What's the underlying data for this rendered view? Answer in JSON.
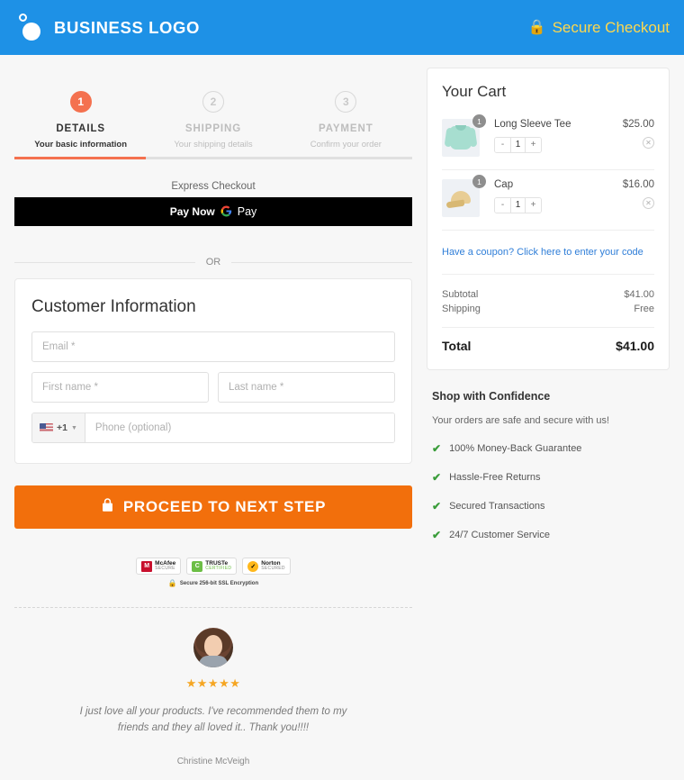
{
  "header": {
    "brand_name": "BUSINESS LOGO",
    "secure_label": "Secure Checkout",
    "lock_icon": "lock-icon",
    "bg_color": "#1e91e6",
    "secure_color": "#ffd84d"
  },
  "stepper": {
    "accent_color": "#f4714f",
    "progress_percent": 33,
    "steps": [
      {
        "number": "1",
        "title": "DETAILS",
        "subtitle": "Your basic information",
        "state": "active"
      },
      {
        "number": "2",
        "title": "SHIPPING",
        "subtitle": "Your shipping details",
        "state": "idle"
      },
      {
        "number": "3",
        "title": "PAYMENT",
        "subtitle": "Confirm your order",
        "state": "idle"
      }
    ]
  },
  "express": {
    "label": "Express Checkout",
    "pay_now": "Pay Now",
    "g_logo": "G",
    "pay_word": "Pay",
    "or_text": "OR"
  },
  "form": {
    "title": "Customer Information",
    "email_placeholder": "Email *",
    "email_value": "",
    "first_name_placeholder": "First name *",
    "first_name_value": "",
    "last_name_placeholder": "Last name *",
    "last_name_value": "",
    "country_code": "+1",
    "flag_icon": "us-flag-icon",
    "phone_placeholder": "Phone (optional)",
    "phone_value": ""
  },
  "cta": {
    "label": "PROCEED TO NEXT STEP",
    "lock_icon": "lock-icon",
    "color": "#f26f0c"
  },
  "trust": {
    "badges": [
      {
        "top": "McAfee",
        "bottom": "SECURE",
        "icon": "mcafee-shield-icon",
        "mark": "M"
      },
      {
        "top": "TRUSTe",
        "bottom": "CERTIFIED",
        "icon": "truste-icon",
        "mark": "C"
      },
      {
        "top": "Norton",
        "bottom": "SECURED",
        "icon": "norton-check-icon",
        "mark": "✓"
      }
    ],
    "ssl_text": "Secure 256-bit SSL Encryption",
    "ssl_icon": "lock-icon"
  },
  "testimonial": {
    "avatar_icon": "customer-avatar",
    "stars": "★★★★★",
    "rating": 5,
    "quote": "I just love all your products. I've recommended them to my friends and they all loved it.. Thank you!!!!",
    "author": "Christine McVeigh"
  },
  "cart": {
    "title": "Your Cart",
    "items": [
      {
        "name": "Long Sleeve Tee",
        "price": "$25.00",
        "qty": "1",
        "qty_badge": "1",
        "image_icon": "long-sleeve-tee-image",
        "minus": "-",
        "plus": "+",
        "remove_icon": "remove-item-icon"
      },
      {
        "name": "Cap",
        "price": "$16.00",
        "qty": "1",
        "qty_badge": "1",
        "image_icon": "cap-image",
        "minus": "-",
        "plus": "+",
        "remove_icon": "remove-item-icon"
      }
    ],
    "coupon_link": "Have a coupon? Click here to enter your code",
    "coupon_color": "#2f7ed8",
    "subtotal_label": "Subtotal",
    "subtotal_value": "$41.00",
    "shipping_label": "Shipping",
    "shipping_value": "Free",
    "total_label": "Total",
    "total_value": "$41.00"
  },
  "confidence": {
    "title": "Shop with Confidence",
    "subtitle": "Your orders are safe and secure with us!",
    "check_color": "#3a9d3a",
    "items": [
      "100% Money-Back Guarantee",
      "Hassle-Free Returns",
      "Secured Transactions",
      "24/7 Customer Service"
    ]
  }
}
